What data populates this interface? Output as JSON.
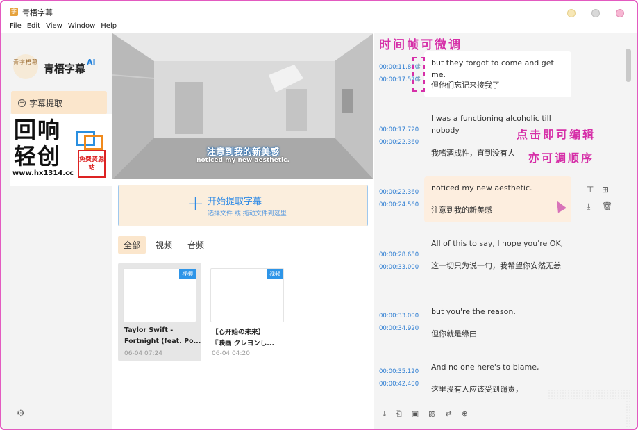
{
  "window": {
    "title": "青梧字幕",
    "app_icon": "字",
    "controls": [
      "minimize",
      "maximize",
      "close"
    ]
  },
  "menu": [
    "File",
    "Edit",
    "View",
    "Window",
    "Help"
  ],
  "sidebar": {
    "logo_text": "青字梧幕",
    "brand": "青梧字幕",
    "brand_suffix": "AI",
    "nav_label": "字幕提取",
    "settings_icon": "gear-icon"
  },
  "watermark": {
    "line1": "回响",
    "line2": "轻创",
    "url": "www.hx1314.cc",
    "badge": "免费资源站"
  },
  "player": {
    "subtitle_zh": "注意到我的新美感",
    "subtitle_en": "noticed my new aesthetic."
  },
  "dropzone": {
    "title": "开始提取字幕",
    "subtitle": "选择文件 或 拖动文件到这里"
  },
  "tabs": [
    "全部",
    "视频",
    "音频"
  ],
  "cards": [
    {
      "badge": "视频",
      "title1": "Taylor Swift -",
      "title2": "Fortnight (feat. Po...",
      "date": "06-04 07:24"
    },
    {
      "badge": "视频",
      "title1": "【心开始の未来】",
      "title2": "『映画 クレヨンし...",
      "date": "06-04 04:20"
    }
  ],
  "annotations": {
    "a1": "时间帧可微调",
    "a2": "点击即可编辑",
    "a3": "亦可调顺序"
  },
  "segments": [
    {
      "start": "00:00:11.880",
      "end": "00:00:17.520",
      "en": "but they forgot to come and get me.",
      "zh": "但他们忘记来接我了"
    },
    {
      "start": "00:00:17.720",
      "end": "00:00:22.360",
      "en": "I was a functioning alcoholic till nobody",
      "zh": "我嗜酒成性，直到没有人"
    },
    {
      "start": "00:00:22.360",
      "end": "00:00:24.560",
      "en": "noticed my new aesthetic.",
      "zh": "注意到我的新美感"
    },
    {
      "start": "00:00:28.680",
      "end": "00:00:33.000",
      "en": "All of this to say, I hope you're OK,",
      "zh": "这一切只为说一句，我希望你安然无恙"
    },
    {
      "start": "00:00:33.000",
      "end": "00:00:34.920",
      "en": "but you're the reason.",
      "zh": "但你就是缘由"
    },
    {
      "start": "00:00:35.120",
      "end": "00:00:42.400",
      "en": "And no one here's to blame,",
      "zh": "这里没有人应该受到谴责，"
    }
  ]
}
